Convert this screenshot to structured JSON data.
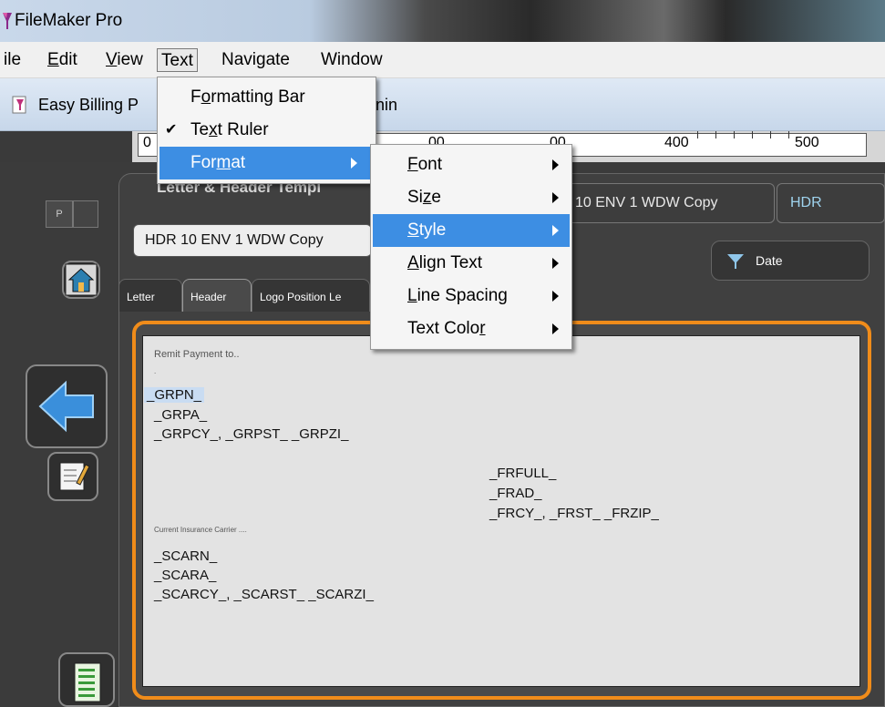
{
  "window": {
    "title": "FileMaker Pro"
  },
  "menubar": {
    "items": [
      {
        "label": "ile",
        "underline_char": ""
      },
      {
        "label_pre": "",
        "u": "E",
        "label_post": "dit"
      },
      {
        "label_pre": "",
        "u": "V",
        "label_post": "iew"
      },
      {
        "label": "Text"
      },
      {
        "label": "Navigate"
      },
      {
        "label": "Window"
      }
    ]
  },
  "toolbar": {
    "doc_name_visible": "Easy Billing P",
    "suffix_visible": "nin"
  },
  "ruler": {
    "labels": [
      "0",
      "00",
      "00",
      "400",
      "500"
    ]
  },
  "text_menu": {
    "formatting_bar": {
      "pre": "F",
      "u": "o",
      "post": "rmatting Bar"
    },
    "text_ruler": {
      "pre": "Te",
      "u": "x",
      "post": "t Ruler",
      "checked": true
    },
    "format": {
      "pre": "For",
      "u": "m",
      "post": "at"
    }
  },
  "format_submenu": {
    "font": {
      "u": "F",
      "post": "ont"
    },
    "size": {
      "pre": "Si",
      "u": "z",
      "post": "e"
    },
    "style": {
      "u": "S",
      "post": "tyle"
    },
    "align": {
      "u": "A",
      "post": "lign Text"
    },
    "line_spacing": {
      "u": "L",
      "post": "ine Spacing"
    },
    "text_color": {
      "pre": "Text Colo",
      "u": "r",
      "post": ""
    }
  },
  "layout": {
    "card_title": "Letter & Header Templ",
    "template_select": "HDR 10 ENV 1 WDW Copy",
    "template_copy_field": "10 ENV 1 WDW Copy",
    "hdr_field": "HDR",
    "date_button": "Date",
    "p_label": "P",
    "tabs": [
      "Letter",
      "Header",
      "Logo Position Le"
    ]
  },
  "document": {
    "remit_label": "Remit Payment to..",
    "dot": ".",
    "grpn": "_GRPN_",
    "grpa": "_GRPA_",
    "grp_city": "_GRPCY_, _GRPST_ _GRPZI_",
    "frfull": "_FRFULL_",
    "frad": "_FRAD_",
    "fr_city": "_FRCY_, _FRST_ _FRZIP_",
    "carrier_label": "Current Insurance Carrier ....",
    "scarn": "_SCARN_",
    "scara": "_SCARA_",
    "scar_city": "_SCARCY_, _SCARST_ _SCARZI_"
  },
  "colors": {
    "menu_highlight": "#3d8ee3",
    "frame_orange": "#f08c1a",
    "hdr_text": "#9fd3ee",
    "arrow_blue": "#3a8fdb"
  }
}
